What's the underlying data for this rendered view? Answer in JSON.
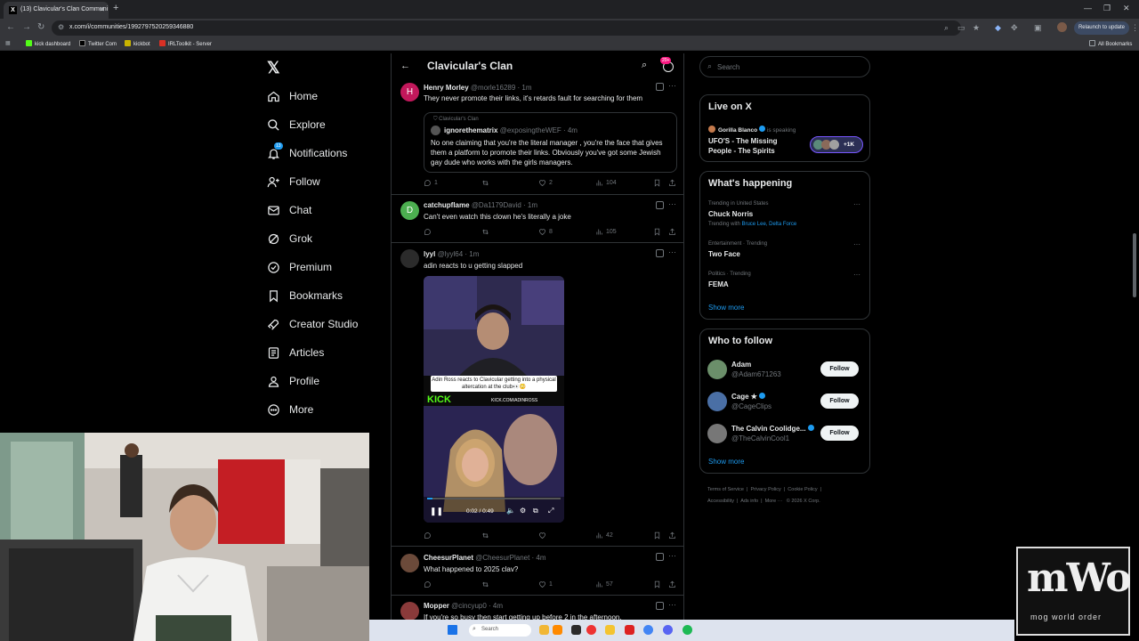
{
  "browser": {
    "tab_title": "(13) Clavicular's Clan Communi",
    "url": "x.com/i/communities/1992797520259346880",
    "relaunch_label": "Relaunch to update",
    "bookmarks": [
      "kick dashboard",
      "Twitter Com",
      "kickbot",
      "IRLToolkit - Server"
    ],
    "all_bookmarks": "All Bookmarks"
  },
  "nav": {
    "items": [
      {
        "label": "Home",
        "icon": "home-icon"
      },
      {
        "label": "Explore",
        "icon": "search-icon"
      },
      {
        "label": "Notifications",
        "icon": "bell-icon",
        "badge": "13"
      },
      {
        "label": "Follow",
        "icon": "follow-icon"
      },
      {
        "label": "Chat",
        "icon": "mail-icon"
      },
      {
        "label": "Grok",
        "icon": "grok-icon"
      },
      {
        "label": "Premium",
        "icon": "premium-icon"
      },
      {
        "label": "Bookmarks",
        "icon": "bookmark-icon"
      },
      {
        "label": "Creator Studio",
        "icon": "rocket-icon"
      },
      {
        "label": "Articles",
        "icon": "article-icon"
      },
      {
        "label": "Profile",
        "icon": "person-icon"
      },
      {
        "label": "More",
        "icon": "more-icon"
      }
    ]
  },
  "community": {
    "title": "Clavicular's Clan",
    "badge": "20+"
  },
  "posts": [
    {
      "name": "Henry Morley",
      "handle": "@morle16289 · 1m",
      "avatar_letter": "H",
      "text": "They never promote their links, it's retards fault for searching for them",
      "quote": {
        "community": "Clavicular's Clan",
        "name": "ignorethematrix",
        "handle": "@exposingtheWEF · 4m",
        "text": "No one claiming that you're the literal manager , you're the face that gives them a platform to promote their links. Obviously you've got some Jewish gay dude who works with the girls managers."
      },
      "replies": "1",
      "likes": "2",
      "views": "104"
    },
    {
      "name": "catchupflame",
      "handle": "@Da1179David · 1m",
      "avatar_letter": "D",
      "text": "Can't even watch this clown he's literally a joke",
      "replies": "",
      "likes": "8",
      "views": "105"
    },
    {
      "name": "lyyl",
      "handle": "@lyyl64 · 1m",
      "text": "adin reacts to u getting slapped",
      "video": {
        "caption": "Adin Ross reacts to Clavicular getting into a physical altercation at the club👀😳",
        "kick_label": "KICK",
        "kick_url": "KICK.COM/ADINROSS",
        "time": "0:02 / 0:49"
      },
      "replies": "",
      "likes": "",
      "views": "42"
    },
    {
      "name": "CheesurPlanet",
      "handle": "@CheesurPlanet · 4m",
      "text": "What happened to 2025 clav?",
      "replies": "",
      "likes": "1",
      "views": "57"
    },
    {
      "name": "Mopper",
      "handle": "@cincyup0 · 4m",
      "text": "If you're so busy then start getting up before 2 in the afternoon."
    }
  ],
  "right": {
    "search_placeholder": "Search",
    "live": {
      "title": "Live on X",
      "host": "Gorilla Blanco",
      "status": "is speaking",
      "space_title_1": "UFO'S - The Missing",
      "space_title_2": "People - The Spirits",
      "listeners": "+1K"
    },
    "happening": {
      "title": "What's happening",
      "trends": [
        {
          "context": "Trending in United States",
          "name": "Chuck Norris",
          "with_label": "Trending with",
          "with_links": "Bruce Lee, Delta Force"
        },
        {
          "context": "Entertainment · Trending",
          "name": "Two Face"
        },
        {
          "context": "Politics · Trending",
          "name": "FEMA"
        }
      ],
      "show_more": "Show more"
    },
    "who_to_follow": {
      "title": "Who to follow",
      "users": [
        {
          "name": "Adam",
          "handle": "@Adam671263",
          "verified": false
        },
        {
          "name": "Cage ★",
          "handle": "@CageClips",
          "verified": true
        },
        {
          "name": "The Calvin Coolidge...",
          "handle": "@TheCalvinCool1",
          "verified": true
        }
      ],
      "follow_label": "Follow",
      "show_more": "Show more"
    },
    "footer": {
      "links": [
        "Terms of Service",
        "Privacy Policy",
        "Cookie Policy",
        "Accessibility",
        "Ads info",
        "More ···",
        "© 2026 X Corp."
      ]
    }
  },
  "taskbar": {
    "search": "Search"
  },
  "overlay": {
    "logo_line1": "mWo",
    "logo_line2": "mog world order"
  },
  "colors": {
    "accent": "#1d9bf0",
    "background": "#000000",
    "border": "#2f3336",
    "muted": "#71767b"
  }
}
